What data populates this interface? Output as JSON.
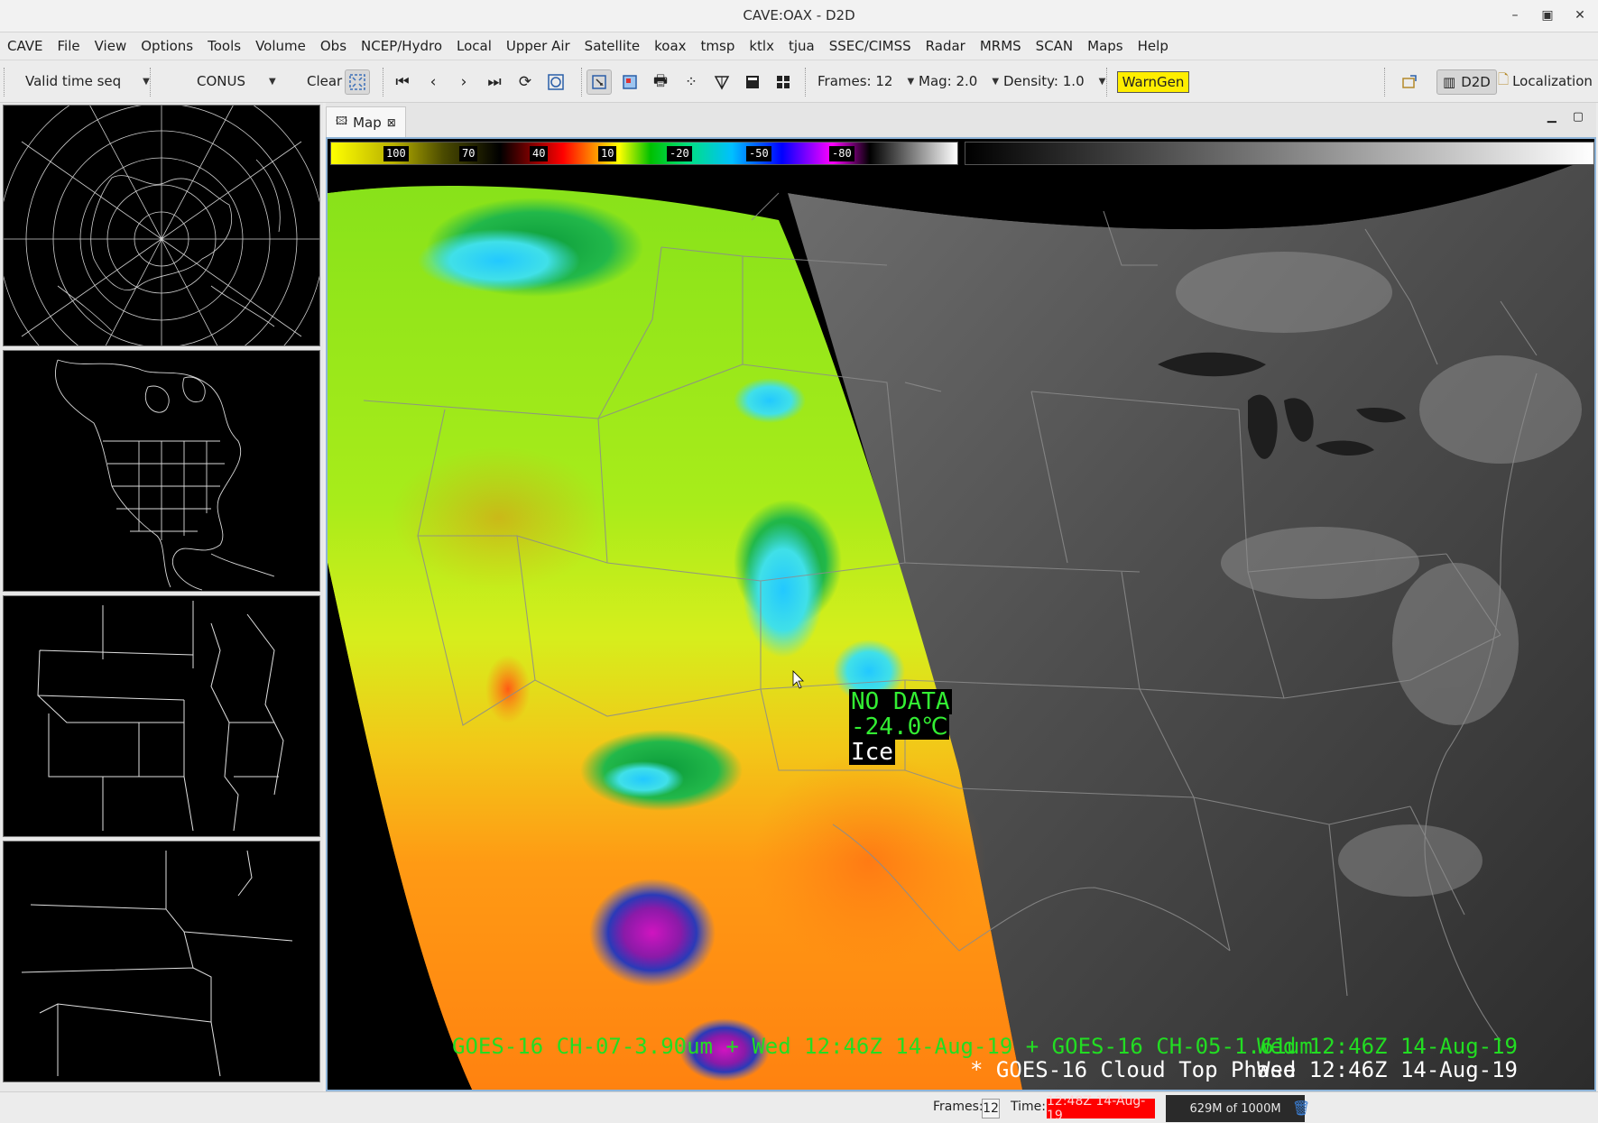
{
  "window": {
    "title": "CAVE:OAX - D2D",
    "controls": [
      "–",
      "▣",
      "✕"
    ]
  },
  "menu": [
    "CAVE",
    "File",
    "View",
    "Options",
    "Tools",
    "Volume",
    "Obs",
    "NCEP/Hydro",
    "Local",
    "Upper Air",
    "Satellite",
    "koax",
    "tmsp",
    "ktlx",
    "tjua",
    "SSEC/CIMSS",
    "Radar",
    "MRMS",
    "SCAN",
    "Maps",
    "Help"
  ],
  "toolbar": {
    "time_mode": "Valid time seq",
    "scale": "CONUS",
    "clear": "Clear",
    "frames": "Frames: 12",
    "mag": "Mag: 2.0",
    "density": "Density: 1.0",
    "warngen": "WarnGen",
    "perspective": "D2D",
    "localization": "Localization"
  },
  "map": {
    "tab_label": "Map",
    "colorbar_labels": [
      "100",
      "70",
      "40",
      "10",
      "-20",
      "-50",
      "-80"
    ],
    "sample": {
      "line1": "NO DATA",
      "line2": "-24.0℃",
      "line3": "Ice"
    },
    "legend1": "GOES-16 CH-07-3.90um + Wed 12:46Z 14-Aug-19 + GOES-16 CH-05-1.61um",
    "legend1_time": "Wed 12:46Z 14-Aug-19",
    "legend2": "* GOES-16 Cloud Top Phase",
    "legend2_time": "Wed 12:46Z 14-Aug-19",
    "colors": {
      "legend1": "#22dd22",
      "legend2": "#ffffff",
      "sample_text": "#33ee33"
    }
  },
  "status": {
    "frames_label": "Frames:",
    "frames_value": "12",
    "time_label": "Time:",
    "time_value": "12:48Z 14-Aug-19",
    "memory": "629M of 1000M"
  }
}
